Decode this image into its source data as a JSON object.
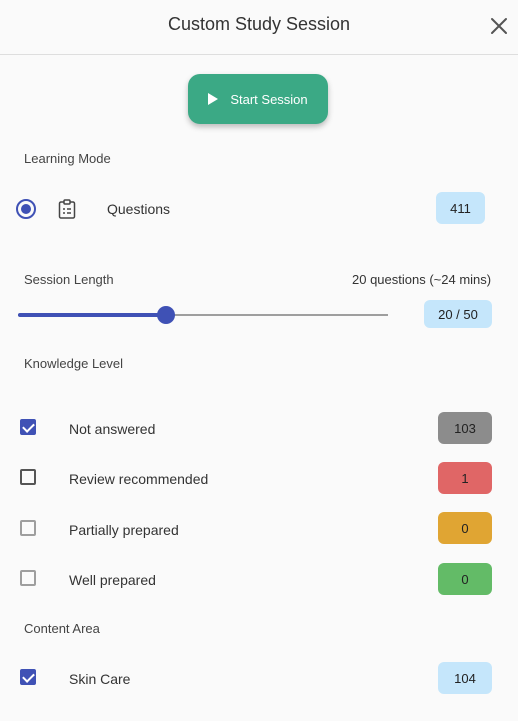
{
  "header": {
    "title": "Custom Study Session"
  },
  "start_button": {
    "label": "Start Session"
  },
  "learning_mode": {
    "label": "Learning Mode",
    "option": {
      "label": "Questions",
      "count": "411",
      "selected": true
    }
  },
  "session_length": {
    "label": "Session Length",
    "summary": "20 questions (~24 mins)",
    "value_text": "20 / 50",
    "value": 20,
    "max": 50
  },
  "knowledge_level": {
    "label": "Knowledge Level",
    "items": [
      {
        "label": "Not answered",
        "count": "103",
        "checked": true,
        "color": "#8c8c8c"
      },
      {
        "label": "Review recommended",
        "count": "1",
        "checked": false,
        "color": "#e06666"
      },
      {
        "label": "Partially prepared",
        "count": "0",
        "checked": false,
        "color": "#e0a533"
      },
      {
        "label": "Well prepared",
        "count": "0",
        "checked": false,
        "color": "#63bb67"
      }
    ]
  },
  "content_area": {
    "label": "Content Area",
    "items": [
      {
        "label": "Skin Care",
        "count": "104",
        "checked": true
      }
    ]
  },
  "colors": {
    "accent": "#3f51b5",
    "start_button": "#3ba985",
    "info_badge": "#c5e6fb"
  }
}
